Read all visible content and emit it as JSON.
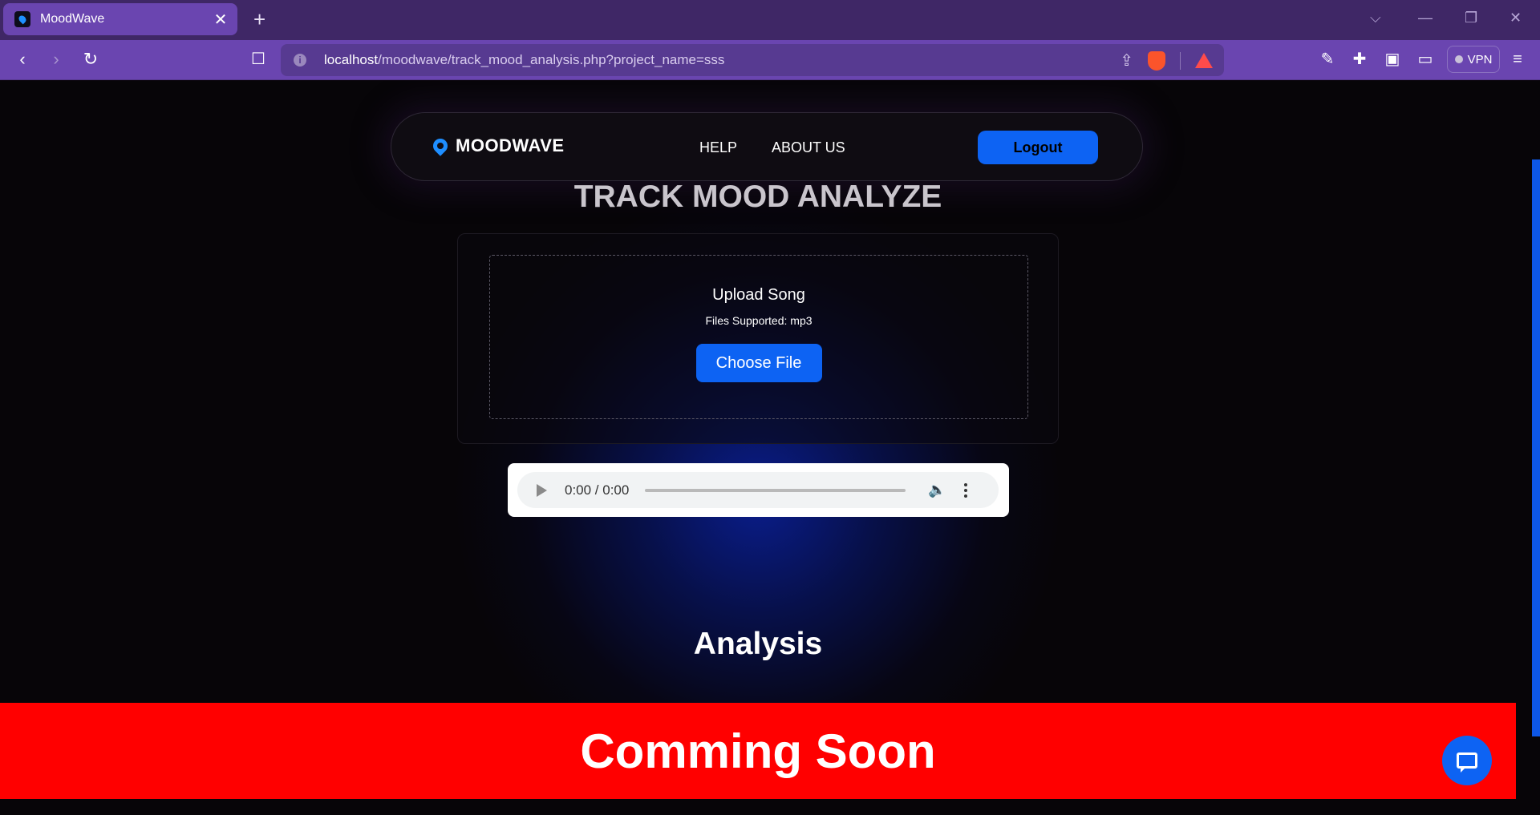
{
  "browser": {
    "tab_title": "MoodWave",
    "tab_close": "✕",
    "new_tab": "+",
    "url_host": "localhost",
    "url_path": "/moodwave/track_mood_analysis.php?project_name=sss",
    "vpn_label": "VPN",
    "icons": [
      "back-icon",
      "forward-icon",
      "reload-icon",
      "bookmark-icon",
      "site-info-icon",
      "share-icon",
      "brave-shields-icon",
      "brave-rewards-icon",
      "eyedropper-icon",
      "extensions-icon",
      "sidebar-icon",
      "wallet-icon",
      "menu-icon"
    ]
  },
  "nav": {
    "brand": "MOODWAVE",
    "links": [
      "HELP",
      "ABOUT US"
    ],
    "logout": "Logout"
  },
  "page": {
    "title": "TRACK MOOD ANALYZE",
    "upload": {
      "heading": "Upload Song",
      "supported": "Files Supported: mp3",
      "button": "Choose File"
    },
    "player": {
      "time": "0:00 / 0:00"
    },
    "analysis_heading": "Analysis",
    "banner": "Comming Soon"
  },
  "colors": {
    "accent": "#0d63f3",
    "banner": "#ff0000",
    "browser_frame": "#6a45b0"
  }
}
